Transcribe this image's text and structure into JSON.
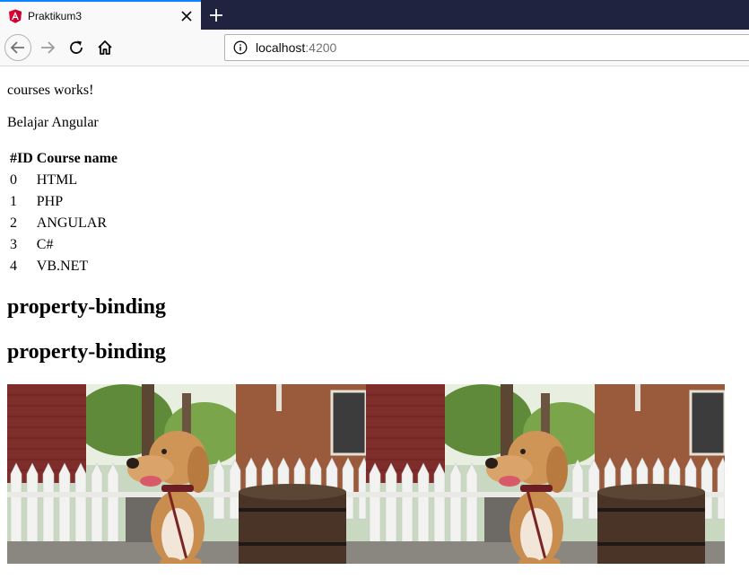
{
  "browser": {
    "tab": {
      "title": "Praktikum3",
      "favicon": "angular-logo-icon"
    },
    "url": {
      "host": "localhost",
      "port": ":4200"
    }
  },
  "page": {
    "status_text": "courses works!",
    "subtitle": "Belajar Angular",
    "table": {
      "headers": [
        "#ID",
        "Course name"
      ],
      "rows": [
        [
          "0",
          "HTML"
        ],
        [
          "1",
          "PHP"
        ],
        [
          "2",
          "ANGULAR"
        ],
        [
          "3",
          "C#"
        ],
        [
          "4",
          "VB.NET"
        ]
      ]
    },
    "headings": [
      "property-binding",
      "property-binding"
    ],
    "images": [
      "dog-photo",
      "dog-photo"
    ]
  },
  "colors": {
    "tabbar_bg": "#202340",
    "tab_accent": "#0a84ff",
    "angular_red": "#dd0031"
  }
}
